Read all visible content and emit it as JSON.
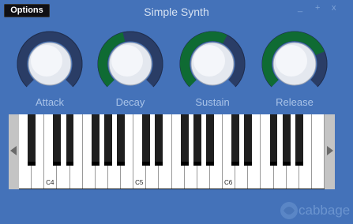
{
  "window": {
    "title": "Simple Synth",
    "minimize": "_",
    "maximize": "+",
    "close": "x"
  },
  "options_button": {
    "label": "Options"
  },
  "knobs": [
    {
      "label": "Attack",
      "value": 0.0
    },
    {
      "label": "Decay",
      "value": 0.45
    },
    {
      "label": "Sustain",
      "value": 0.6
    },
    {
      "label": "Release",
      "value": 0.75
    }
  ],
  "keyboard": {
    "white_keys": 24,
    "note_labels": [
      "C4",
      "C5",
      "C6"
    ]
  },
  "branding": {
    "text": "cabbage"
  },
  "colors": {
    "background": "#4472b9",
    "knob_fill": "#0f6b33",
    "knob_track": "#2a3d66",
    "label": "#a9c3e8"
  }
}
